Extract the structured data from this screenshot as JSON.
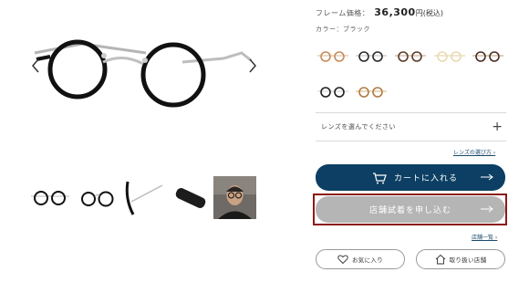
{
  "product": {
    "price_label": "フレーム価格：",
    "price_value": "36,300",
    "price_currency_tax": "円(税込)",
    "color_label": "カラー：ブラック"
  },
  "colors": {
    "swatches": [
      {
        "name": "tortoise-gold",
        "rim": "#c98a5a",
        "temple": "#d9b48a"
      },
      {
        "name": "black-silver",
        "rim": "#2a2a2a",
        "temple": "#b9b9b9"
      },
      {
        "name": "brown-silver",
        "rim": "#5a3b2a",
        "temple": "#c0a080"
      },
      {
        "name": "clear-gold",
        "rim": "#e8d9b0",
        "temple": "#e2cf9a"
      },
      {
        "name": "dark-tortoise",
        "rim": "#4a2f25",
        "temple": "#b89a7a"
      },
      {
        "name": "black-gold",
        "rim": "#1f1f1f",
        "temple": "#cfcfcf"
      },
      {
        "name": "demi-gold",
        "rim": "#b07a45",
        "temple": "#d8b47a"
      }
    ]
  },
  "lens": {
    "select_label": "レンズを選んでください",
    "guide_link": "レンズの選び方 ›"
  },
  "actions": {
    "cart_label": "カートに入れる",
    "store_trial_label": "店舗試着を申し込む",
    "store_list_link": "店舗一覧 ›",
    "favorite_label": "お気に入り",
    "stores_label": "取り扱い店舗"
  },
  "colors_theme": {
    "cart_bg": "#0c3f63",
    "store_btn_bg": "#b5b5b5",
    "highlight_border": "#8b1a1a",
    "link": "#1b4a6b"
  }
}
